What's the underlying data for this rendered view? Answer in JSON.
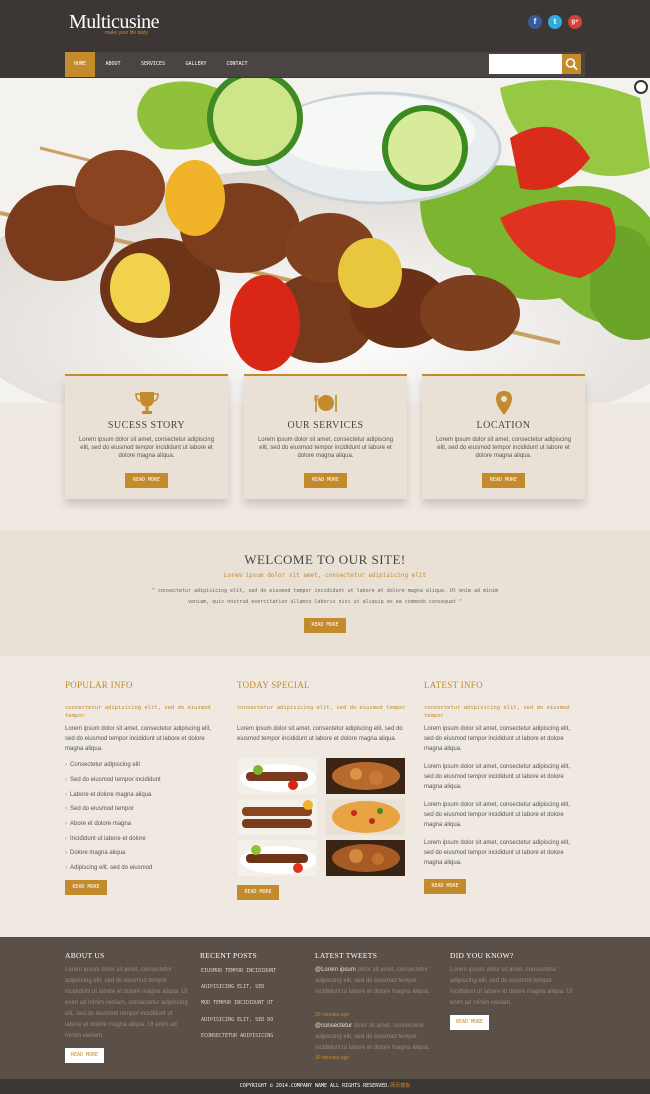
{
  "header": {
    "logo": "Multicusine",
    "tagline": "make your life tasty",
    "social": [
      "f",
      "t",
      "g+"
    ]
  },
  "nav": {
    "items": [
      "HOME",
      "ABOUT",
      "SERVICES",
      "GALLERY",
      "CONTACT"
    ],
    "active": "HOME"
  },
  "search": {
    "placeholder": ""
  },
  "features": [
    {
      "title": "SUCESS STORY",
      "text": "Lorem ipsum dolor sit amet, consectetur adipiscing elit, sed do eiusmod tempor incididunt ut labore et dolore magna aliqua.",
      "button": "READ MORE",
      "icon": "trophy-icon"
    },
    {
      "title": "OUR SERVICES",
      "text": "Lorem ipsum dolor sit amet, consectetur adipiscing elit, sed do eiusmod tempor incididunt ut labore et dolore magna aliqua.",
      "button": "READ MORE",
      "icon": "dining-icon"
    },
    {
      "title": "LOCATION",
      "text": "Lorem ipsum dolor sit amet, consectetur adipiscing elit, sed do eiusmod tempor incididunt ut labore et dolore magna aliqua.",
      "button": "READ MORE",
      "icon": "map-pin-icon"
    }
  ],
  "welcome": {
    "title": "WELCOME TO OUR SITE!",
    "subtitle": "Lorem ipsum dolor sit amet, consectetur adipisicing elit",
    "description": "\" consectetur adipisicing elit, sed do eiusmod tempor incididunt ut labore et dolore magna aliqua. Ut enim ad minim veniam, quis nostrud exercitation ullamco laboris nisi ut aliquip ex ea commodo consequat \"",
    "button": "READ MORE"
  },
  "popular": {
    "title": "POPULAR INFO",
    "subtitle": "consectetur adipisicing elit, sed do eiusmod tempor",
    "text": "Lorem ipsum dolor sit amet, consectetur adipiscing elit, sed do eiusmod tempor incididunt ut labore et dolore magna aliqua.",
    "list": [
      "Consectetur adipiscing elit",
      "Sed do eiusmod tempor incididunt",
      "Labore et dolore magna aliqua",
      "Sed do eiusmod tempor",
      "Abore et dolore magna",
      "Incididunt ut labore et dolore",
      "Dolore magna aliqua",
      "Adipiscing elit, sed do eiusmod"
    ],
    "button": "READ MORE"
  },
  "special": {
    "title": "TODAY SPECIAL",
    "subtitle": "consectetur adipisicing elit, sed do eiusmod tempor",
    "text": "Lorem ipsum dolor sit amet, consectetur adipiscing elit, sed do eiusmod tempor incididunt ut labore et dolore magna aliqua.",
    "button": "READ MORE"
  },
  "latest": {
    "title": "LATEST INFO",
    "subtitle": "consectetur adipisicing elit, sed do eiusmod tempor",
    "paragraphs": [
      "Lorem ipsum dolor sit amet, consectetur adipiscing elit, sed do eiusmod tempor incididunt ut labore et dolore magna aliqua.",
      "Lorem ipsum dolor sit amet, consectetur adipiscing elit, sed do eiusmod tempor incididunt ut labore et dolore magna aliqua.",
      "Lorem ipsum dolor sit amet, consectetur adipiscing elit, sed do eiusmod tempor incididunt ut labore et dolore magna aliqua.",
      "Lorem ipsum dolor sit amet, consectetur adipiscing elit, sed do eiusmod tempor incididunt ut labore et dolore magna aliqua."
    ],
    "button": "READ MORE"
  },
  "footer": {
    "about": {
      "title": "ABOUT US",
      "text": "Lorem ipsum dolor sit amet, consectetur adipiscing elit, sed do eiusmod tempor incididunt ut labore et dolore magna aliqua. Ut enim ad minim veniam, consectetur adipiscing elit, sed do eiusmod tempor incididunt ut labore et dolore magna aliqua. Ut enim ad minim veniam.",
      "button": "READ MORE"
    },
    "posts": {
      "title": "RECENT POSTS",
      "items": [
        "EIUSMOD TEMPOR INCIDIDUNT",
        "ADIPISICING ELIT, SED",
        "MOD TEMPOR INCIDIDUNT UT",
        "ADIPISICING ELIT, SED DO",
        "ECONSECTETUR ADIPISICING"
      ]
    },
    "tweets": {
      "title": "LATEST TWEETS",
      "items": [
        {
          "user": "@Lorem ipsum",
          "text": "dolor sit amet, consectetur adipiscing elit, sed do eiusmod tempor incididunt ut labore et dolore magna aliqua.",
          "time": "30 minutes ago"
        },
        {
          "user": "@consectetur",
          "text": "dolor sit amet, consectetur adipiscing elit, sed do eiusmod tempor incididunt ut labore et dolore magna aliqua.",
          "time": "30 minutes ago"
        }
      ]
    },
    "know": {
      "title": "DID YOU KNOW?",
      "text": "Lorem ipsum dolor sit amet, consectetur adipiscing elit, sed do eiusmod tempor incididunt ut labore et dolore magna aliqua. Ut enim ad minim veniam.",
      "button": "READ MORE"
    }
  },
  "copyright": {
    "text": "COPYRIGHT © 2014.COMPANY NAME ALL RIGHTS RESERVED.",
    "link": "网页模板"
  },
  "colors": {
    "accent": "#c38b2b",
    "header_bg": "#3c3735",
    "footer_bg": "#5a5048",
    "cream": "#efe9e1"
  }
}
